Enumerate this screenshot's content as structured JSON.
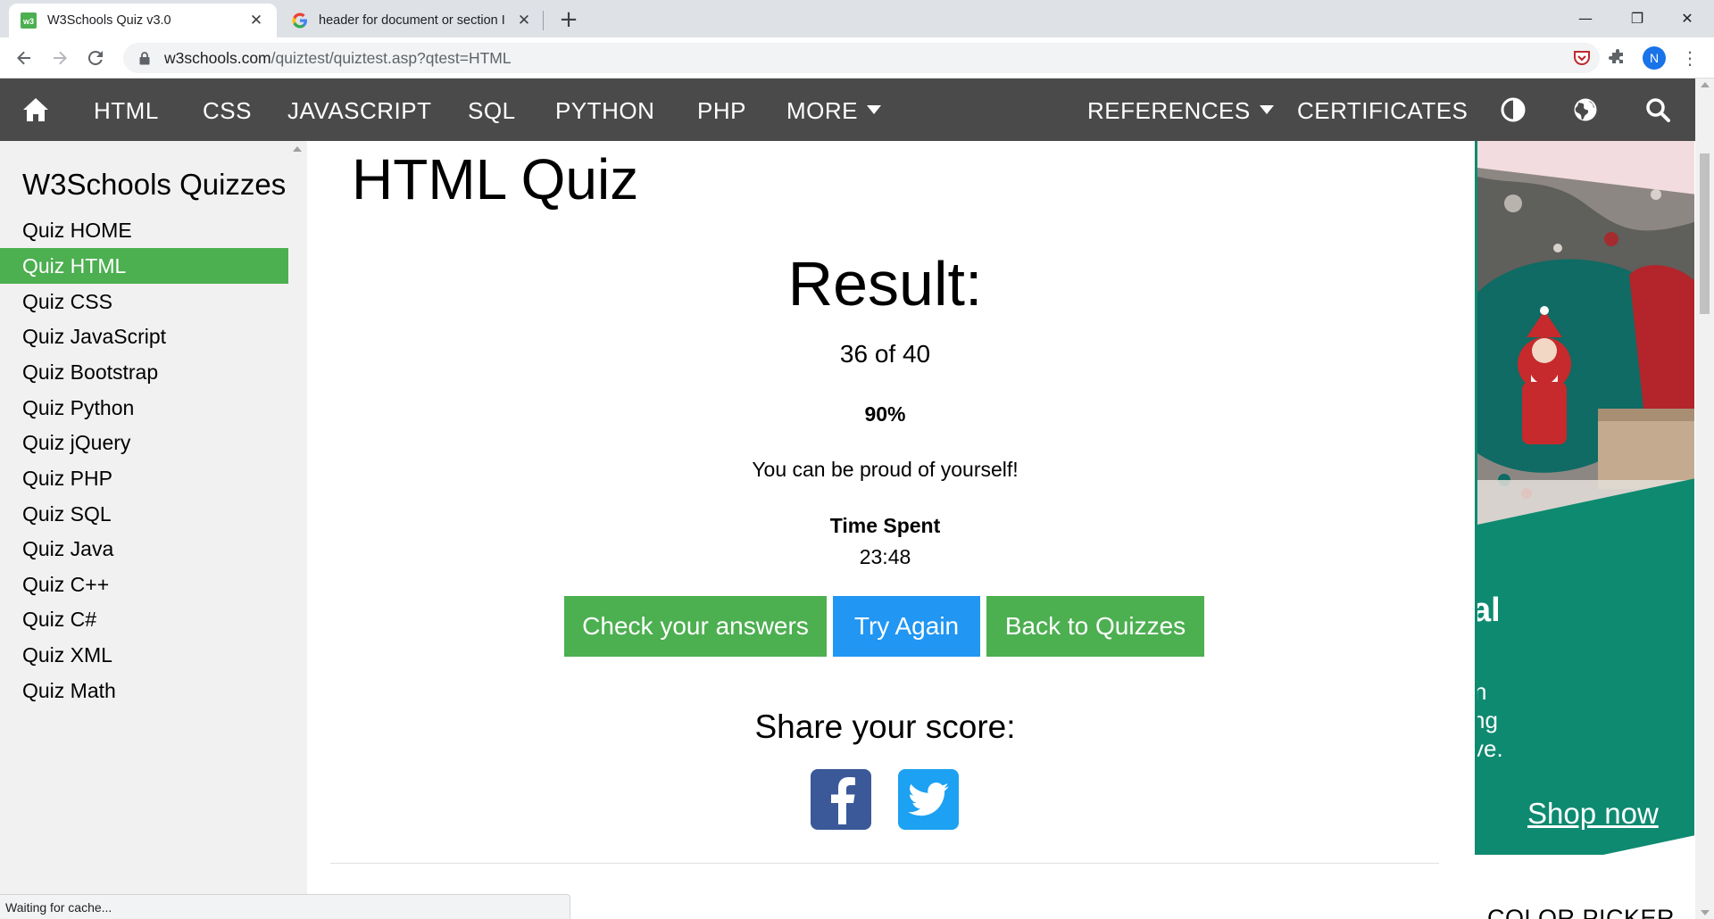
{
  "browser": {
    "tabs": [
      {
        "title": "W3Schools Quiz v3.0",
        "active": true
      },
      {
        "title": "header for document or section I",
        "active": false
      }
    ],
    "new_tab": "+",
    "window_controls": {
      "minimize": "—",
      "restore": "❐",
      "close": "✕"
    },
    "url_host": "w3schools.com",
    "url_path": "/quiztest/quiztest.asp?qtest=HTML",
    "profile_initial": "N",
    "status_text": "Waiting for cache..."
  },
  "topnav": {
    "items": [
      "HTML",
      "CSS",
      "JAVASCRIPT",
      "SQL",
      "PYTHON",
      "PHP",
      "MORE",
      "REFERENCES",
      "CERTIFICATES"
    ]
  },
  "sidebar": {
    "title": "W3Schools Quizzes",
    "items": [
      {
        "label": "Quiz HOME",
        "active": false
      },
      {
        "label": "Quiz HTML",
        "active": true
      },
      {
        "label": "Quiz CSS",
        "active": false
      },
      {
        "label": "Quiz JavaScript",
        "active": false
      },
      {
        "label": "Quiz Bootstrap",
        "active": false
      },
      {
        "label": "Quiz Python",
        "active": false
      },
      {
        "label": "Quiz jQuery",
        "active": false
      },
      {
        "label": "Quiz PHP",
        "active": false
      },
      {
        "label": "Quiz SQL",
        "active": false
      },
      {
        "label": "Quiz Java",
        "active": false
      },
      {
        "label": "Quiz C++",
        "active": false
      },
      {
        "label": "Quiz C#",
        "active": false
      },
      {
        "label": "Quiz XML",
        "active": false
      },
      {
        "label": "Quiz Math",
        "active": false
      }
    ]
  },
  "main": {
    "title": "HTML Quiz",
    "result_heading": "Result:",
    "score": "36 of 40",
    "percent": "90%",
    "message": "You can be proud of yourself!",
    "time_label": "Time Spent",
    "time_value": "23:48",
    "buttons": {
      "check": "Check your answers",
      "retry": "Try Again",
      "back": "Back to Quizzes"
    },
    "share_heading": "Share your score:"
  },
  "ad": {
    "text_fragments": [
      "al",
      "n",
      "ng",
      "ve."
    ],
    "link": "Shop now"
  },
  "right_column_heading": "COLOR PICKER",
  "colors": {
    "nav_bg": "#4a4a4a",
    "accent_green": "#4caf50",
    "accent_blue": "#2196f3",
    "facebook": "#3b5998",
    "twitter": "#1da1f2",
    "ad_green": "#0e8a70"
  }
}
